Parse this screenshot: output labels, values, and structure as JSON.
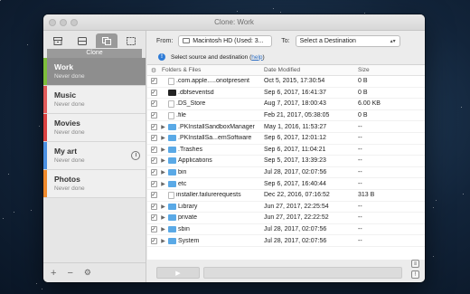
{
  "window": {
    "title": "Clone: Work"
  },
  "sidebar": {
    "tabs": [
      {
        "icon": "archive-icon"
      },
      {
        "icon": "disk-icon"
      },
      {
        "icon": "clone-icon"
      },
      {
        "icon": "restore-icon"
      }
    ],
    "active_tab_label": "Clone",
    "tasks": [
      {
        "name": "Work",
        "status": "Never done",
        "color": "#7dbe3c"
      },
      {
        "name": "Music",
        "status": "Never done",
        "color": "#e05a5a"
      },
      {
        "name": "Movies",
        "status": "Never done",
        "color": "#d94141"
      },
      {
        "name": "My art",
        "status": "Never done",
        "color": "#4a90e2"
      },
      {
        "name": "Photos",
        "status": "Never done",
        "color": "#f08a2c"
      }
    ],
    "footer": {
      "add": "+",
      "remove": "−",
      "settings": "⚙"
    }
  },
  "toolbar": {
    "from_label": "From:",
    "from_value": "Macintosh HD (Used: 3...",
    "to_label": "To:",
    "to_value": "Select a Destination"
  },
  "info": {
    "message": "Select source and destination (",
    "link": "help",
    "suffix": ")"
  },
  "table": {
    "headers": {
      "name": "Folders & Files",
      "date": "Date Modified",
      "size": "Size"
    },
    "rows": [
      {
        "folder": false,
        "dark": false,
        "name": ".com.apple.....onotpresent",
        "date": "Oct 5, 2015, 17:30:54",
        "size": "0 B"
      },
      {
        "folder": false,
        "dark": true,
        "name": ".dbfseventsd",
        "date": "Sep 6, 2017, 16:41:37",
        "size": "0 B"
      },
      {
        "folder": false,
        "dark": false,
        "name": ".DS_Store",
        "date": "Aug 7, 2017, 18:00:43",
        "size": "6.00 KB"
      },
      {
        "folder": false,
        "dark": false,
        "name": ".file",
        "date": "Feb 21, 2017, 05:38:05",
        "size": "0 B"
      },
      {
        "folder": true,
        "name": ".PKInstallSandboxManager",
        "date": "May 1, 2016, 11:53:27",
        "size": "--"
      },
      {
        "folder": true,
        "name": ".PKInstallSa...emSoftware",
        "date": "Sep 6, 2017, 12:01:12",
        "size": "--"
      },
      {
        "folder": true,
        "name": ".Trashes",
        "date": "Sep 6, 2017, 11:04:21",
        "size": "--"
      },
      {
        "folder": true,
        "name": "Applications",
        "date": "Sep 5, 2017, 13:39:23",
        "size": "--"
      },
      {
        "folder": true,
        "name": "bin",
        "date": "Jul 28, 2017, 02:07:56",
        "size": "--"
      },
      {
        "folder": true,
        "name": "etc",
        "date": "Sep 6, 2017, 16:40:44",
        "size": "--"
      },
      {
        "folder": false,
        "dark": false,
        "name": "installer.failurerequests",
        "date": "Dec 22, 2016, 07:16:52",
        "size": "313 B"
      },
      {
        "folder": true,
        "name": "Library",
        "date": "Jun 27, 2017, 22:25:54",
        "size": "--"
      },
      {
        "folder": true,
        "name": "private",
        "date": "Jun 27, 2017, 22:22:52",
        "size": "--"
      },
      {
        "folder": true,
        "name": "sbin",
        "date": "Jul 28, 2017, 02:07:56",
        "size": "--"
      },
      {
        "folder": true,
        "name": "System",
        "date": "Jul 28, 2017, 02:07:56",
        "size": "--"
      }
    ]
  },
  "bottom": {
    "play_icon": "play-icon"
  }
}
